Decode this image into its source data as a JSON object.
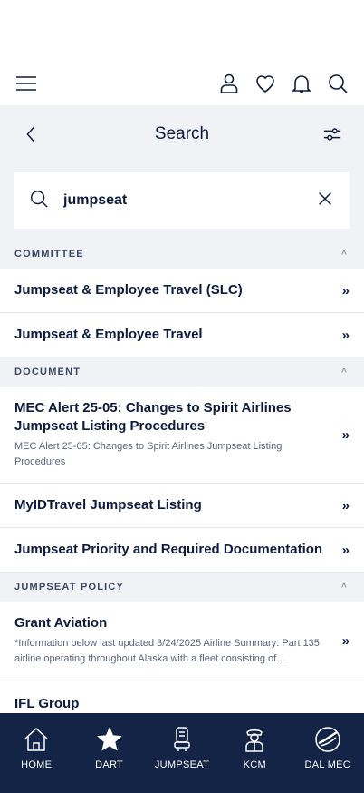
{
  "header": {
    "menu_icon": "hamburger-icon",
    "icons": [
      "user-icon",
      "heart-icon",
      "bell-icon",
      "search-icon"
    ]
  },
  "search": {
    "title": "Search",
    "query": "jumpseat"
  },
  "sections": [
    {
      "label": "COMMITTEE",
      "items": [
        {
          "title": "Jumpseat & Employee Travel (SLC)"
        },
        {
          "title": "Jumpseat & Employee Travel"
        }
      ]
    },
    {
      "label": "DOCUMENT",
      "items": [
        {
          "title": "MEC Alert 25-05: Changes to Spirit Airlines Jumpseat Listing Procedures",
          "desc": "MEC Alert 25-05: Changes to Spirit Airlines Jumpseat Listing Procedures"
        },
        {
          "title": "MyIDTravel Jumpseat Listing"
        },
        {
          "title": "Jumpseat Priority and Required Documentation"
        }
      ]
    },
    {
      "label": "JUMPSEAT POLICY",
      "items": [
        {
          "title": "Grant Aviation",
          "desc": "*Information below last updated 3/24/2025 Airline Summary: Part 135 airline operating throughout Alaska with a fleet consisting of..."
        },
        {
          "title": "IFL Group"
        }
      ]
    }
  ],
  "chevron": "»",
  "caret": "^",
  "bottom_nav": [
    {
      "label": "HOME",
      "icon": "home-icon"
    },
    {
      "label": "DART",
      "icon": "star-icon"
    },
    {
      "label": "JUMPSEAT",
      "icon": "jumpseat-icon"
    },
    {
      "label": "KCM",
      "icon": "pilot-icon"
    },
    {
      "label": "DAL MEC",
      "icon": "dal-mec-logo-icon"
    }
  ]
}
